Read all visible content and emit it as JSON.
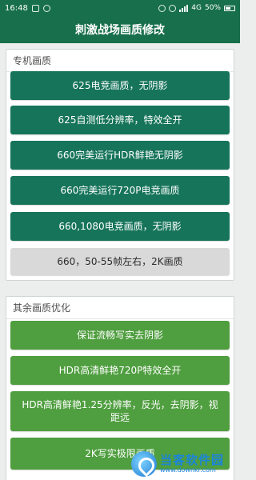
{
  "status_bar": {
    "time": "16:48",
    "network": "4G",
    "battery": "50%"
  },
  "header": {
    "title": "刺激战场画质修改"
  },
  "sections": [
    {
      "title": "专机画质",
      "options": [
        {
          "label": "625电竞画质，无阴影",
          "style": "teal"
        },
        {
          "label": "625自测低分辨率，特效全开",
          "style": "teal"
        },
        {
          "label": "660完美运行HDR鲜艳无阴影",
          "style": "teal"
        },
        {
          "label": "660完美运行720P电竞画质",
          "style": "teal"
        },
        {
          "label": "660,1080电竞画质，无阴影",
          "style": "teal"
        },
        {
          "label": "660，50-55帧左右，2K画质",
          "style": "gray"
        }
      ]
    },
    {
      "title": "其余画质优化",
      "options": [
        {
          "label": "保证流畅写实去阴影",
          "style": "green"
        },
        {
          "label": "HDR高清鲜艳720P特效全开",
          "style": "green"
        },
        {
          "label": "HDR高清鲜艳1.25分辨率，反光，去阴影，视距远",
          "style": "green"
        },
        {
          "label": "2K写实极限画质",
          "style": "green"
        }
      ]
    }
  ],
  "watermark": {
    "main": "当客软件园",
    "sub": "www.downkr.com"
  },
  "colors": {
    "primary": "#186f4b",
    "option_teal": "#16745a",
    "option_green": "#4f9e3f",
    "option_selected": "#d8d9d8",
    "background": "#eceeed"
  }
}
